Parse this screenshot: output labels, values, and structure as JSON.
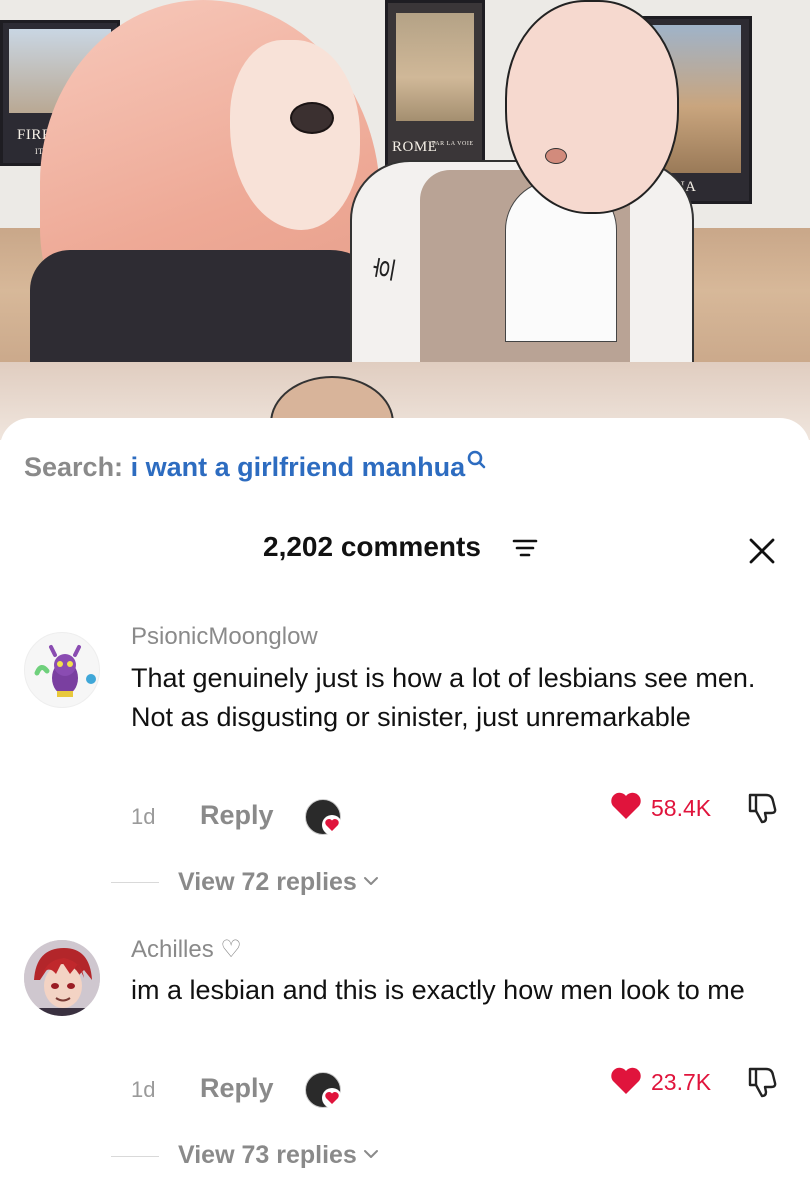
{
  "comic": {
    "posters": [
      {
        "name": "FIRENZE",
        "sub": "ITALIA"
      },
      {
        "name": "ROME",
        "sub": "PAR LA VOIE"
      },
      {
        "name": "VERONA"
      }
    ],
    "sfx": "흐"
  },
  "search": {
    "prefix": "Search:",
    "query": "i want a girlfriend manhua"
  },
  "header": {
    "comments_count": "2,202 comments"
  },
  "comments": [
    {
      "username": "PsionicMoonglow",
      "text": "That genuinely just is how a lot of lesbians see men. Not as disgusting or sinister, just unremarkable",
      "time": "1d",
      "reply_label": "Reply",
      "likes": "58.4K",
      "view_replies": "View 72 replies"
    },
    {
      "username": "Achilles ♡",
      "text": "im a lesbian and this is exactly how men look to me",
      "time": "1d",
      "reply_label": "Reply",
      "likes": "23.7K",
      "view_replies": "View 73 replies"
    }
  ],
  "colors": {
    "accent_blue": "#2d6cc0",
    "like_red": "#e0143c",
    "muted_gray": "#8a8a8a"
  }
}
